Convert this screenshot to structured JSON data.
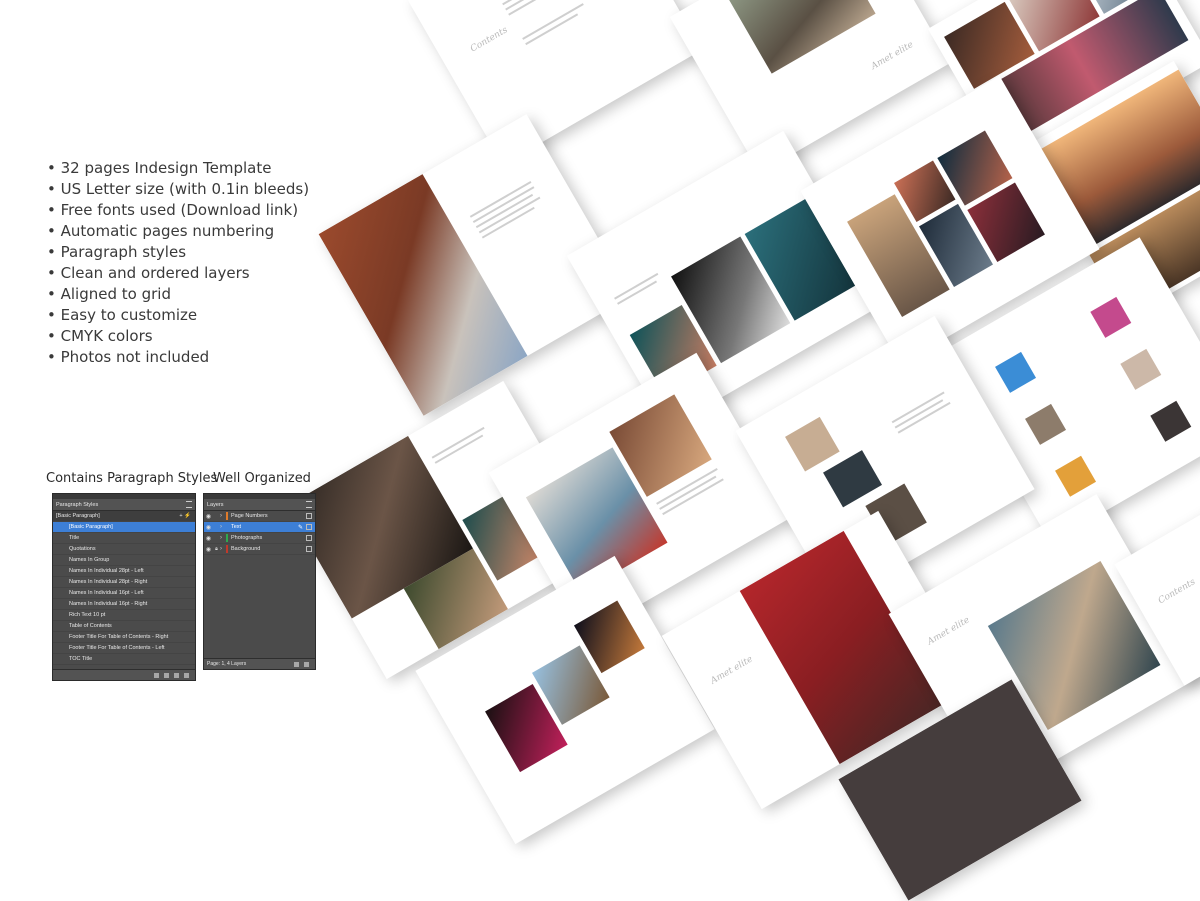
{
  "features": [
    "32 pages Indesign Template",
    "US  Letter size (with 0.1in bleeds)",
    "Free fonts used (Download link)",
    "Automatic pages numbering",
    "Paragraph styles",
    "Clean and ordered layers",
    "Aligned to grid",
    "Easy to customize",
    "CMYK colors",
    "Photos not included"
  ],
  "captions": {
    "paragraph_styles": "Contains Paragraph Styles",
    "layers": "Well Organized"
  },
  "paragraph_panel": {
    "title": "Paragraph Styles",
    "base_style": "[Basic Paragraph]",
    "styles": [
      "[Basic Paragraph]",
      "Title",
      "Quotations",
      "Names In Group",
      "Names In Individual 28pt - Left",
      "Names In Individual 28pt - Right",
      "Names In Individual 16pt - Left",
      "Names In Individual 16pt - Right",
      "Rich Text 10 pt",
      "Table of Contents",
      "Footer Title For Table of Contents - Right",
      "Footer Title For Table of Contents - Left",
      "TOC Title"
    ]
  },
  "layers_panel": {
    "title": "Layers",
    "layers": [
      {
        "name": "Page Numbers",
        "color": "#e07b2a"
      },
      {
        "name": "Text",
        "color": "#3d7fd6"
      },
      {
        "name": "Photographs",
        "color": "#2fa84f"
      },
      {
        "name": "Background",
        "color": "#c0392b"
      }
    ],
    "status": "Page: 1, 4 Layers"
  },
  "mockup_text": {
    "contents": "Contents",
    "amet_elite": "Amet elite"
  },
  "colors": {
    "panel_bg": "#4b4b4b",
    "selection": "#3d7fd6",
    "accent_red": "#b3262b"
  }
}
